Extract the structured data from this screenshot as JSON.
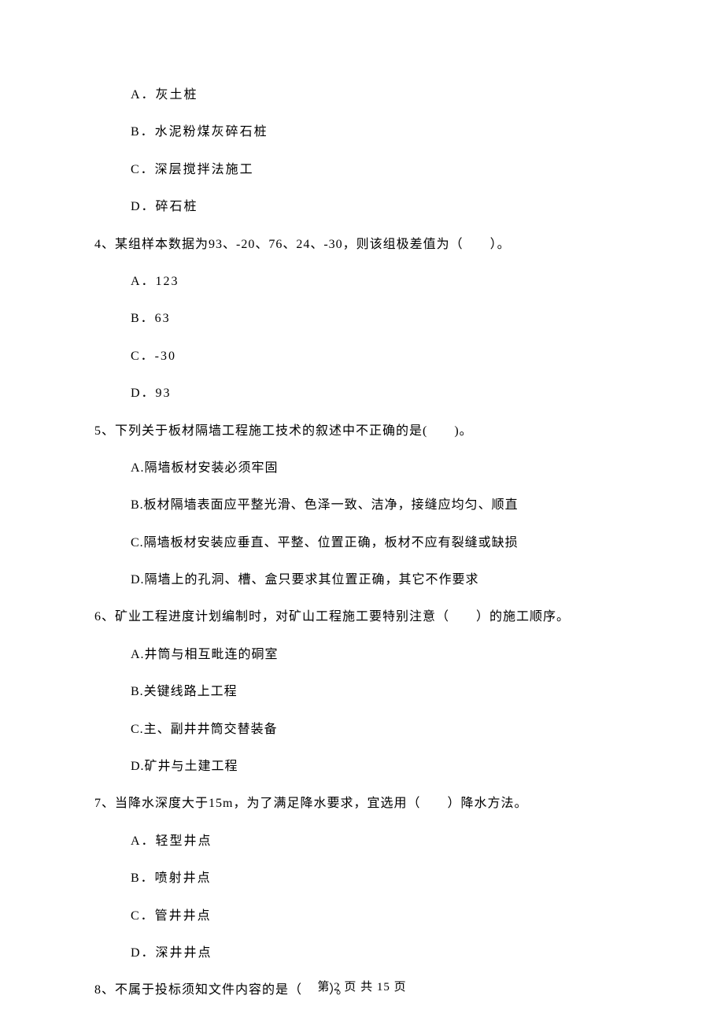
{
  "preOptions": {
    "a": "A．灰土桩",
    "b": "B．水泥粉煤灰碎石桩",
    "c": "C．深层搅拌法施工",
    "d": "D．碎石桩"
  },
  "q4": {
    "stem": "4、某组样本数据为93、-20、76、24、-30，则该组极差值为（　　）。",
    "a": "A．123",
    "b": "B．63",
    "c": "C．-30",
    "d": "D．93"
  },
  "q5": {
    "stem": "5、下列关于板材隔墙工程施工技术的叙述中不正确的是(　　)。",
    "a": "A.隔墙板材安装必须牢固",
    "b": "B.板材隔墙表面应平整光滑、色泽一致、洁净，接缝应均匀、顺直",
    "c": "C.隔墙板材安装应垂直、平整、位置正确，板材不应有裂缝或缺损",
    "d": "D.隔墙上的孔洞、槽、盒只要求其位置正确，其它不作要求"
  },
  "q6": {
    "stem": "6、矿业工程进度计划编制时，对矿山工程施工要特别注意（　　）的施工顺序。",
    "a": "A.井筒与相互毗连的硐室",
    "b": "B.关键线路上工程",
    "c": "C.主、副井井筒交替装备",
    "d": "D.矿井与土建工程"
  },
  "q7": {
    "stem": "7、当降水深度大于15m，为了满足降水要求，宜选用（　　）降水方法。",
    "a": "A．轻型井点",
    "b": "B．喷射井点",
    "c": "C．管井井点",
    "d": "D．深井井点"
  },
  "q8": {
    "stem": "8、不属于投标须知文件内容的是（　　）。"
  },
  "footer": "第 2 页 共 15 页"
}
